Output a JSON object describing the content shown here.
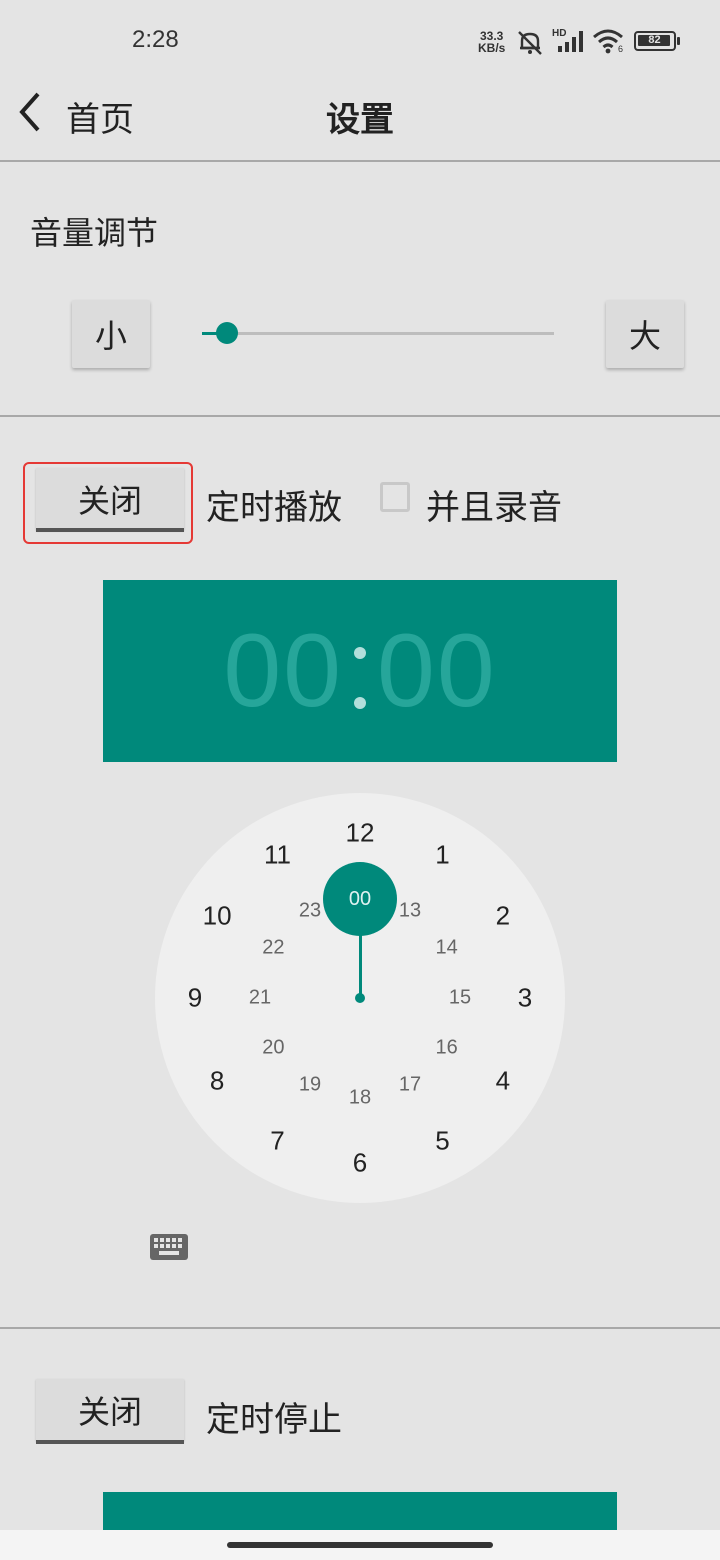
{
  "status": {
    "time": "2:28",
    "net_speed_value": "33.3",
    "net_speed_unit": "KB/s",
    "hd": "HD",
    "wifi_badge": "6",
    "battery": "82"
  },
  "header": {
    "back_label": "首页",
    "title": "设置"
  },
  "volume": {
    "title": "音量调节",
    "minus_label": "小",
    "plus_label": "大",
    "level_fraction": 0.07
  },
  "timed_play": {
    "toggle_label": "关闭",
    "label": "定时播放",
    "record_label": "并且录音",
    "record_checked": false,
    "time_hours": "00",
    "time_minutes": "00",
    "selected_label": "00",
    "dial_outer": [
      "12",
      "1",
      "2",
      "3",
      "4",
      "5",
      "6",
      "7",
      "8",
      "9",
      "10",
      "11"
    ],
    "dial_inner": [
      "00",
      "13",
      "14",
      "15",
      "16",
      "17",
      "18",
      "19",
      "20",
      "21",
      "22",
      "23"
    ]
  },
  "timed_stop": {
    "toggle_label": "关闭",
    "label": "定时停止"
  },
  "colors": {
    "accent": "#00897b",
    "highlight": "#e53935"
  }
}
